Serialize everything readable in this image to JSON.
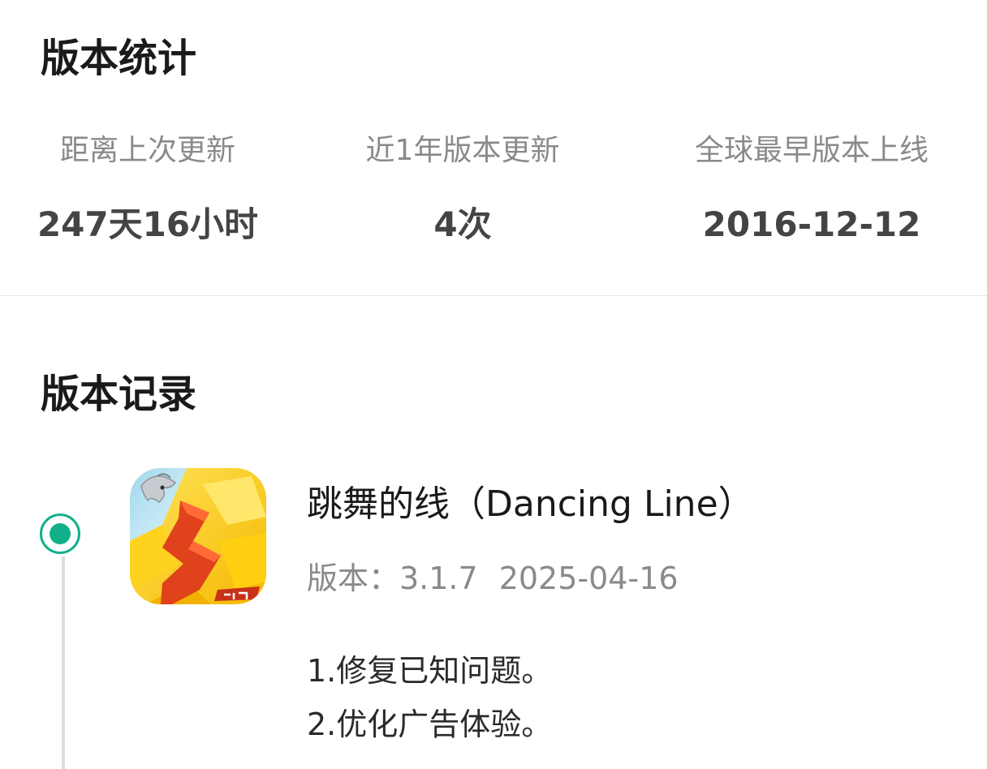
{
  "stats_section": {
    "title": "版本统计",
    "items": [
      {
        "label": "距离上次更新",
        "value": "247天16小时"
      },
      {
        "label": "近1年版本更新",
        "value": "4次"
      },
      {
        "label": "全球最早版本上线",
        "value": "2016-12-12"
      }
    ]
  },
  "records_section": {
    "title": "版本记录",
    "entries": [
      {
        "icon": "dancing-line-app-icon",
        "app_name": "跳舞的线（Dancing Line）",
        "version_text": "版本：3.1.7",
        "date": "2025-04-16",
        "notes": [
          "1.修复已知问题。",
          "2.优化广告体验。"
        ]
      }
    ]
  },
  "colors": {
    "accent": "#12b08a",
    "timeline_line": "#dcdcdc",
    "label_gray": "#8a8a8a",
    "value_gray": "#444444",
    "divider": "#e6e6e6"
  }
}
